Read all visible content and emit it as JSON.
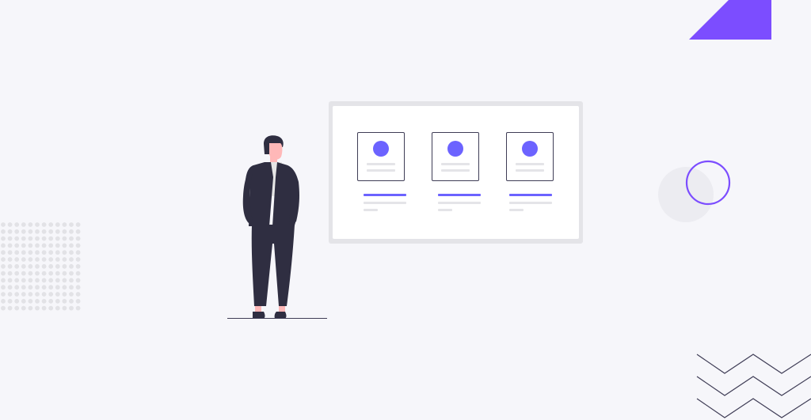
{
  "illustration": {
    "subject": "person-standing-beside-board",
    "board": {
      "cards": [
        {
          "icon": "avatar-circle"
        },
        {
          "icon": "avatar-circle"
        },
        {
          "icon": "avatar-circle"
        }
      ]
    }
  },
  "colors": {
    "background": "#f6f6fa",
    "accent": "#7c4dff",
    "card_accent": "#6c63ff",
    "ink": "#3f3d56",
    "suit": "#2f2e41",
    "skin": "#ffb8b8",
    "line_gray": "#e4e4e8",
    "dots": "#e2e2e6"
  }
}
